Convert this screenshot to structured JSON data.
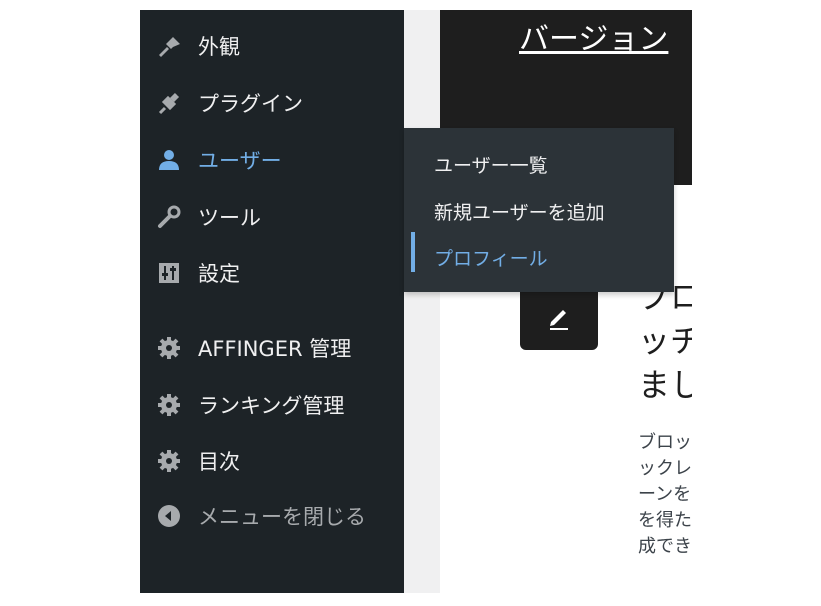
{
  "sidebar": {
    "items": [
      {
        "label": "外観",
        "icon": "paintbrush-icon"
      },
      {
        "label": "プラグイン",
        "icon": "plugin-icon"
      },
      {
        "label": "ユーザー",
        "icon": "user-icon",
        "active": true
      },
      {
        "label": "ツール",
        "icon": "wrench-icon"
      },
      {
        "label": "設定",
        "icon": "settings-sliders-icon"
      },
      {
        "label": "AFFINGER 管理",
        "icon": "gear-icon"
      },
      {
        "label": "ランキング管理",
        "icon": "gear-icon"
      },
      {
        "label": "目次",
        "icon": "gear-icon"
      },
      {
        "label": "メニューを閉じる",
        "icon": "collapse-arrow-icon"
      }
    ]
  },
  "flyout": {
    "items": [
      {
        "label": "ユーザー一覧"
      },
      {
        "label": "新規ユーザーを追加"
      },
      {
        "label": "プロフィール",
        "current": true
      }
    ]
  },
  "content": {
    "banner_title": "バージョン",
    "heading_lines": [
      "プロ",
      "ッチ",
      "まし"
    ],
    "body_lines": [
      "ブロッ",
      "ックレ",
      "ーンを",
      "を得た",
      "成でき"
    ]
  },
  "colors": {
    "sidebar_bg": "#1d2327",
    "flyout_bg": "#2c3338",
    "accent": "#72aee6",
    "text": "#f0f0f1"
  }
}
